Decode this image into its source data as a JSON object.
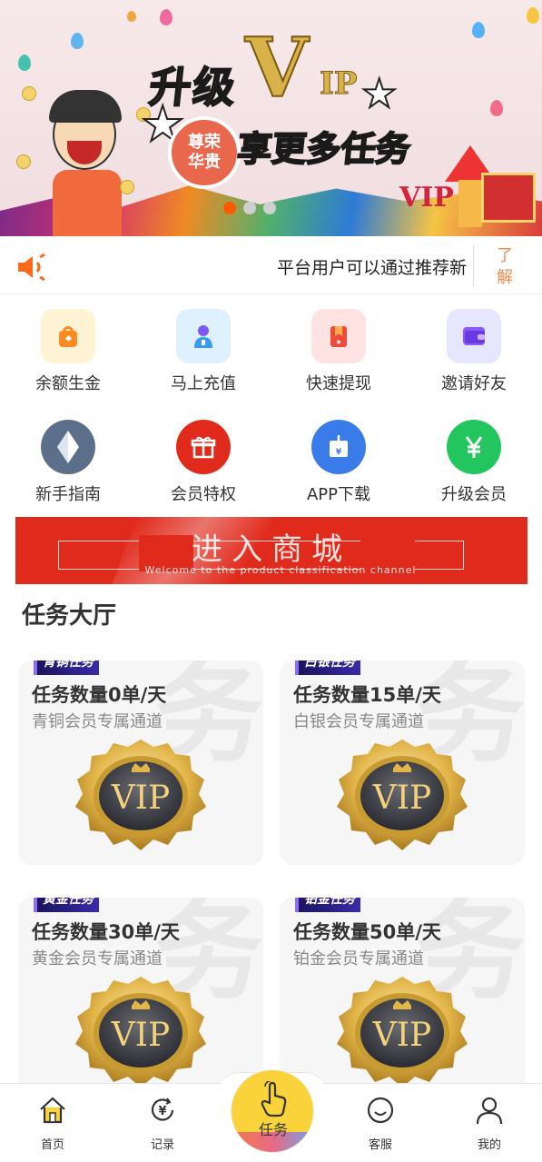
{
  "banner": {
    "title": "升级",
    "vip_text": "V",
    "vip_ip": "IP",
    "subtitle": "享更多任务",
    "badge_line1": "尊荣",
    "badge_line2": "华贵",
    "small_vip": "VIP",
    "carousel_index": 1,
    "carousel_count": 3
  },
  "notice": {
    "text": "平台用户可以通过推荐新",
    "learn_more": "了解"
  },
  "menu": [
    {
      "label": "余额生金",
      "icon": "wallet-bag-icon",
      "color": "#ff8a1f",
      "bg": "#fff3d6"
    },
    {
      "label": "马上充值",
      "icon": "recharge-icon",
      "color": "#4a7cf5",
      "bg": "#dff1ff"
    },
    {
      "label": "快速提现",
      "icon": "withdraw-icon",
      "color": "#f04a3a",
      "bg": "#ffe3e3"
    },
    {
      "label": "邀请好友",
      "icon": "card-icon",
      "color": "#7a4af5",
      "bg": "#e7e6ff"
    },
    {
      "label": "新手指南",
      "icon": "diamond-icon",
      "color": "#5c6f8a",
      "bg": "#5c6f8a"
    },
    {
      "label": "会员特权",
      "icon": "gift-icon",
      "color": "#e02a1c",
      "bg": "#e02a1c"
    },
    {
      "label": "APP下载",
      "icon": "download-icon",
      "color": "#3a7bea",
      "bg": "#3a7bea"
    },
    {
      "label": "升级会员",
      "icon": "yen-icon",
      "color": "#22c55e",
      "bg": "#22c55e"
    }
  ],
  "mall": {
    "title": "进入商城",
    "subtitle": "Welcome to the product classification channel"
  },
  "section_title": "任务大厅",
  "tasks": [
    {
      "tag": "青铜任务",
      "count": "任务数量0单/天",
      "desc": "青铜会员专属通道",
      "seal": "VIP"
    },
    {
      "tag": "白银任务",
      "count": "任务数量15单/天",
      "desc": "白银会员专属通道",
      "seal": "VIP"
    },
    {
      "tag": "黄金任务",
      "count": "任务数量30单/天",
      "desc": "黄金会员专属通道",
      "seal": "VIP"
    },
    {
      "tag": "铂金任务",
      "count": "任务数量50单/天",
      "desc": "铂金会员专属通道",
      "seal": "VIP"
    }
  ],
  "tabbar": {
    "home": "首页",
    "records": "记录",
    "tasks": "任务",
    "service": "客服",
    "mine": "我的"
  },
  "colors": {
    "accent": "#ff5a00",
    "mall_red": "#e02a1c",
    "notice_orange": "#f18a4e",
    "center_yellow": "#f9d339"
  }
}
